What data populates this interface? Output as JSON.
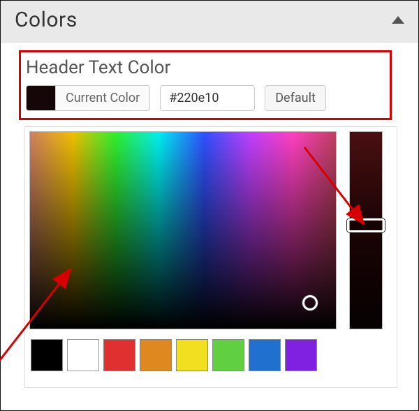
{
  "panel": {
    "title": "Colors"
  },
  "section": {
    "title": "Header Text Color",
    "current_label": "Current Color",
    "hex_value": "#220e10",
    "default_label": "Default",
    "swatch_color": "#150607"
  },
  "palette": [
    "#000000",
    "#ffffff",
    "#e03030",
    "#e08820",
    "#f0e020",
    "#60d040",
    "#2070d0",
    "#8020e0"
  ]
}
